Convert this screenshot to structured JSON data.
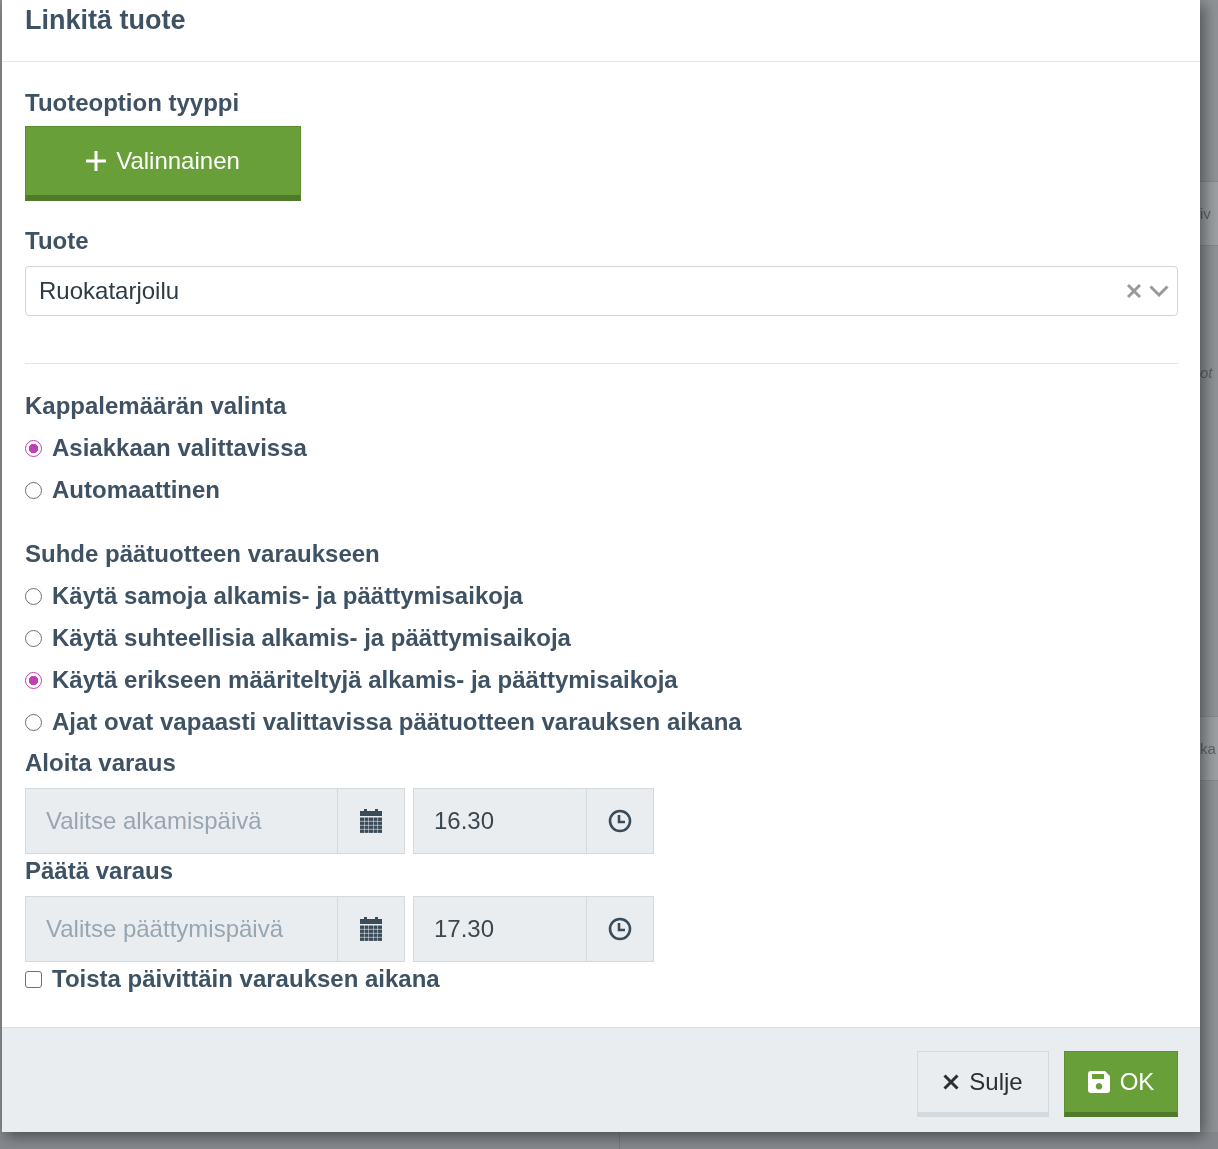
{
  "dialog": {
    "title": "Linkitä tuote"
  },
  "option_type": {
    "label": "Tuoteoption tyyppi",
    "button": {
      "label": "Valinnainen"
    }
  },
  "product": {
    "label": "Tuote",
    "value": "Ruokatarjoilu"
  },
  "quantity_choice": {
    "label": "Kappalemäärän valinta",
    "options": [
      {
        "label": "Asiakkaan valittavissa",
        "selected": true
      },
      {
        "label": "Automaattinen",
        "selected": false
      }
    ]
  },
  "relation": {
    "label": "Suhde päätuotteen varaukseen",
    "options": [
      {
        "label": "Käytä samoja alkamis- ja päättymisaikoja",
        "selected": false
      },
      {
        "label": "Käytä suhteellisia alkamis- ja päättymisaikoja",
        "selected": false
      },
      {
        "label": "Käytä erikseen määriteltyjä alkamis- ja päättymisaikoja",
        "selected": true
      },
      {
        "label": "Ajat ovat vapaasti valittavissa päätuotteen varauksen aikana",
        "selected": false
      }
    ]
  },
  "start": {
    "label": "Aloita varaus",
    "date": {
      "placeholder": "Valitse alkamispäivä"
    },
    "time": {
      "value": "16.30"
    }
  },
  "end": {
    "label": "Päätä varaus",
    "date": {
      "placeholder": "Valitse päättymispäivä"
    },
    "time": {
      "value": "17.30"
    }
  },
  "repeat_daily": {
    "label": "Toista päivittäin varauksen aikana",
    "checked": false
  },
  "footer": {
    "buttons": [
      {
        "label": "Sulje",
        "kind": "close"
      },
      {
        "label": "OK",
        "kind": "save"
      }
    ]
  },
  "background": {
    "fragments": [
      "iv",
      "ot",
      "ka"
    ]
  }
}
